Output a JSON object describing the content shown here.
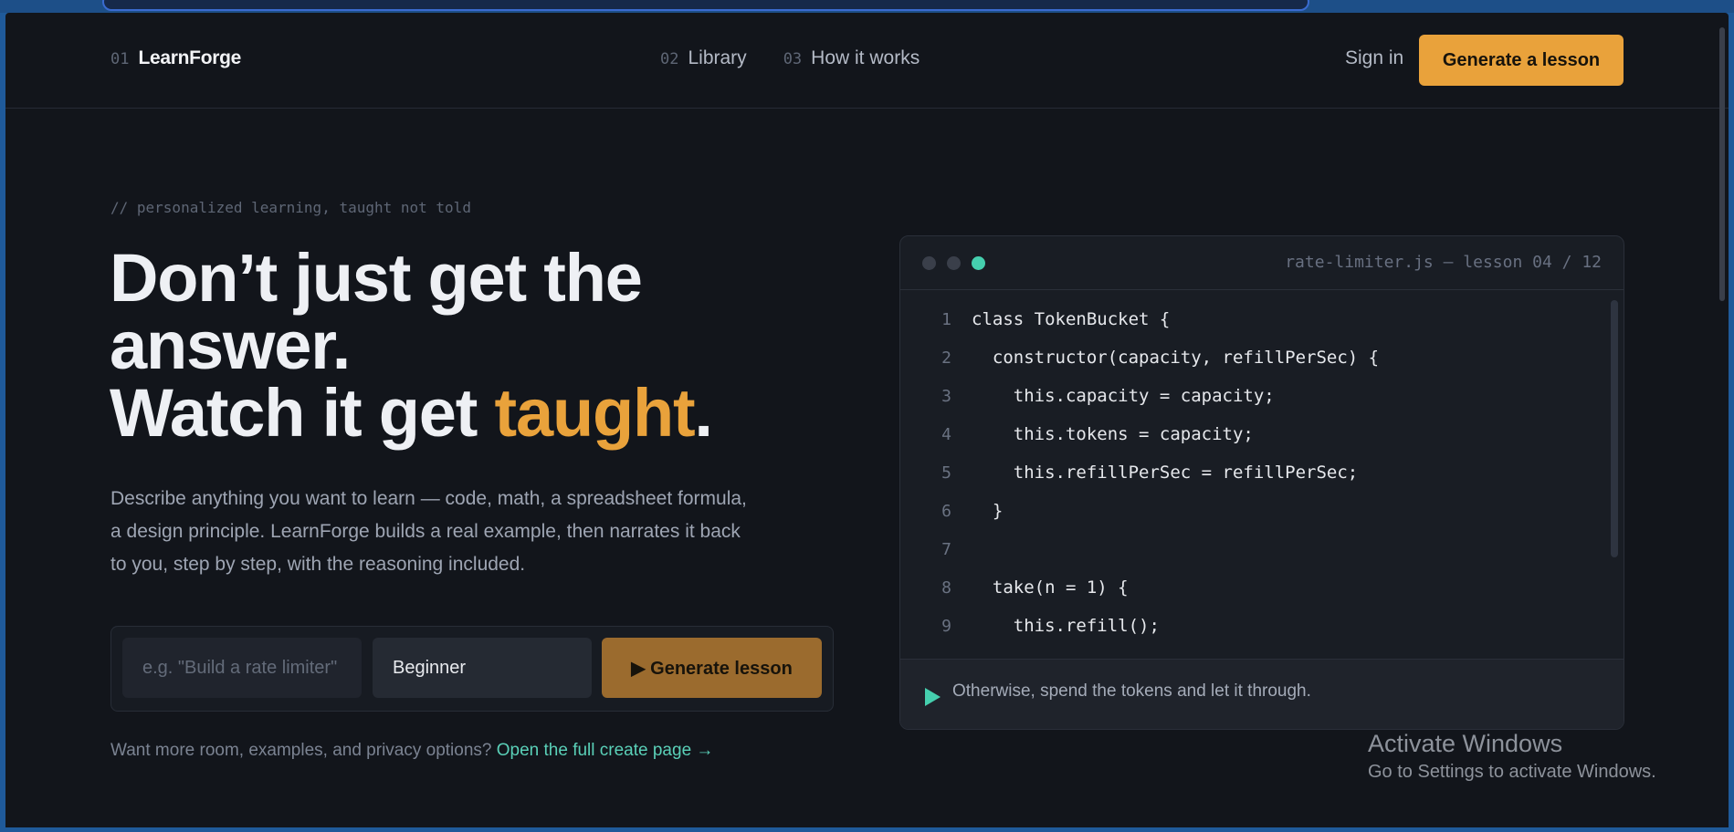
{
  "nav": {
    "brand_num": "01",
    "brand_name": "LearnForge",
    "links": [
      {
        "num": "02",
        "label": "Library"
      },
      {
        "num": "03",
        "label": "How it works"
      }
    ],
    "signin_label": "Sign in",
    "cta_label": "Generate a lesson"
  },
  "hero": {
    "eyebrow": "// personalized learning, taught not told",
    "headline_line1": "Don’t just get the answer.",
    "headline_line2_prefix": "Watch it get ",
    "headline_accent": "taught",
    "headline_suffix": ".",
    "description": "Describe anything you want to learn — code, math, a spreadsheet formula, a design principle. LearnForge builds a real example, then narrates it back to you, step by step, with the reasoning included.",
    "form": {
      "topic_placeholder": "e.g. \"Build a rate limiter\"",
      "level_value": "Beginner",
      "generate_label": "▶ Generate lesson"
    },
    "foot_text": "Want more room, examples, and privacy options?",
    "foot_link": "Open the full create page →"
  },
  "editor": {
    "title": "rate-limiter.js — lesson 04 / 12",
    "lines": [
      {
        "n": "1",
        "code": "class TokenBucket {"
      },
      {
        "n": "2",
        "code": "  constructor(capacity, refillPerSec) {"
      },
      {
        "n": "3",
        "code": "    this.capacity = capacity;"
      },
      {
        "n": "4",
        "code": "    this.tokens = capacity;"
      },
      {
        "n": "5",
        "code": "    this.refillPerSec = refillPerSec;"
      },
      {
        "n": "6",
        "code": "  }"
      },
      {
        "n": "7",
        "code": ""
      },
      {
        "n": "8",
        "code": "  take(n = 1) {"
      },
      {
        "n": "9",
        "code": "    this.refill();"
      }
    ],
    "narration": "Otherwise, spend the tokens and let it through."
  },
  "watermark": {
    "line1": "Activate Windows",
    "line2": "Go to Settings to activate Windows."
  },
  "colors": {
    "accent": "#e9a23b",
    "teal": "#45cfae",
    "background": "#12151b"
  }
}
